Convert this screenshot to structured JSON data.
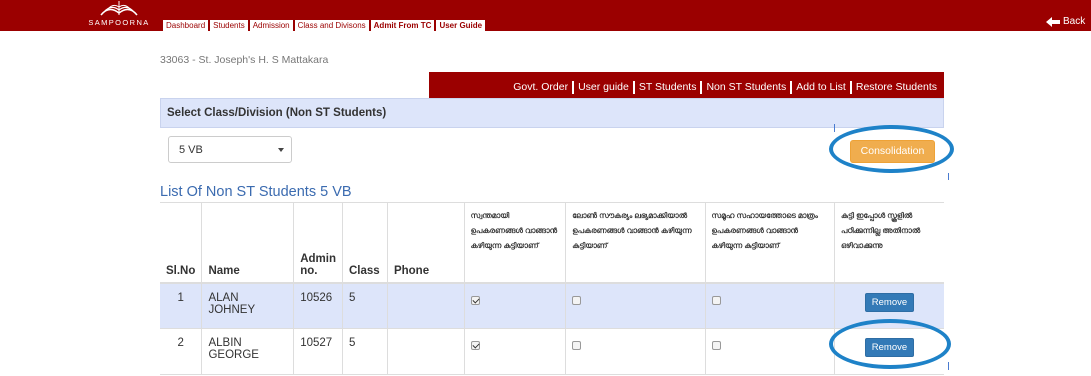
{
  "brand": {
    "name": "SAMPOORNA"
  },
  "topnav": [
    "Dashboard",
    "Students",
    "Admission",
    "Class and Divisons",
    "Admit From TC",
    "User Guide"
  ],
  "back_label": "Back",
  "school": "33063 - St. Joseph's H. S Mattakara",
  "tabs": [
    "Govt. Order",
    "User guide",
    "ST Students",
    "Non ST Students",
    "Add to List",
    "Restore Students"
  ],
  "panel": {
    "heading": "Select Class/Division (Non ST Students)",
    "selected_class": "5 VB",
    "consolidation_label": "Consolidation"
  },
  "list_title": "List Of Non ST Students 5 VB",
  "table": {
    "headers": {
      "slno": "Sl.No",
      "name": "Name",
      "admin": "Admin no.",
      "class": "Class",
      "phone": "Phone",
      "q1": "സ്വന്തമായി ഉപകരണങ്ങൾ വാങ്ങാൻ കഴിയുന്ന കുട്ടിയാണ്",
      "q2": "ലോൺ സൗകര്യം ലഭ്യമാക്കിയാൽ ഉപകരണങ്ങൾ വാങ്ങാൻ കഴിയുന്ന കുട്ടിയാണ്",
      "q3": "സമൂഹ സഹായത്തോടെ മാത്രം ഉപകരണങ്ങൾ വാങ്ങാൻ കഴിയുന്ന കുട്ടിയാണ്",
      "q4": "കുട്ടി ഇപ്പോൾ സ്കൂളിൽ പഠിക്കുന്നില്ല അതിനാൽ ഒഴിവാക്കുന്നു"
    },
    "rows": [
      {
        "slno": "1",
        "name": "ALAN JOHNEY",
        "admin": "10526",
        "class": "5",
        "phone": "",
        "q1": true,
        "q2": false,
        "q3": false,
        "action": "Remove"
      },
      {
        "slno": "2",
        "name": "ALBIN GEORGE",
        "admin": "10527",
        "class": "5",
        "phone": "",
        "q1": true,
        "q2": false,
        "q3": false,
        "action": "Remove"
      }
    ]
  },
  "colors": {
    "brand_red": "#9b0000",
    "panel_blue": "#dde5fa",
    "accent_blue": "#337ab7",
    "warning_orange": "#f0ad4e",
    "highlight_ring": "#1e82c8"
  }
}
